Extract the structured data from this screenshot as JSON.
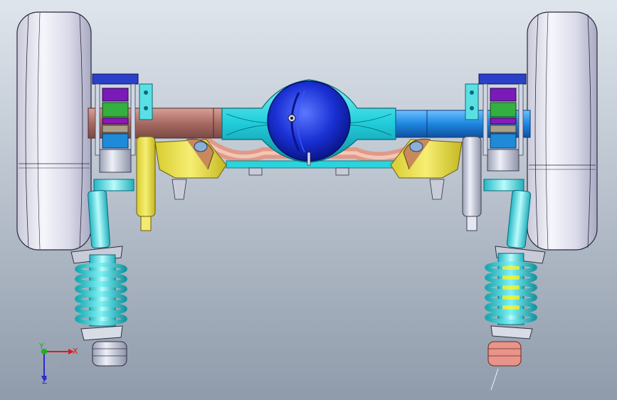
{
  "viewport": {
    "background_top": "#dfe5ec",
    "background_bottom": "#8f9bab"
  },
  "model": {
    "icons": {
      "triad": "axis-triad-icon"
    },
    "colors": {
      "tire": "#e8e8f4",
      "axle_tube_left": "#b07870",
      "axle_center": "#2ad4dc",
      "axle_right": "#1f86e0",
      "diff_cover": "#1428d0",
      "spring": "#3ad3d4",
      "spring_highlight": "#f2f22a",
      "bracket_yellow": "#efe34a",
      "bump_stop": "#e89080",
      "leaf_purple": "#7a1ab8",
      "leaf_green": "#34b040",
      "leaf_blue": "#1e8ad8",
      "frame_blue": "#2a40c8"
    }
  },
  "triad": {
    "x_label": "X",
    "y_label": "Y",
    "z_label": "Z",
    "x_color": "#e01a1a",
    "y_color": "#18b418",
    "z_color": "#2a2ad0"
  }
}
